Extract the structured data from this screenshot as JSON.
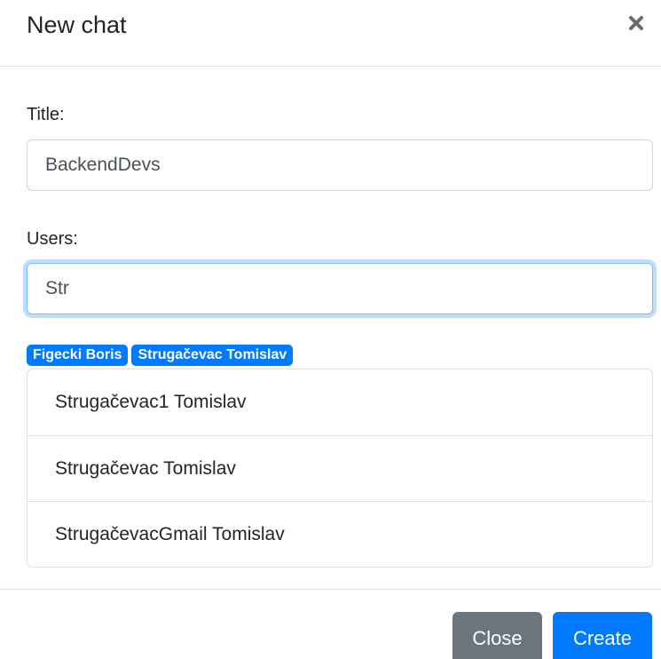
{
  "modal": {
    "title": "New chat"
  },
  "form": {
    "title_label": "Title:",
    "title_value": "BackendDevs",
    "users_label": "Users:",
    "users_value": "Str"
  },
  "selected_users": [
    "Figecki Boris",
    "Strugačevac Tomislav"
  ],
  "suggestions": [
    "Strugačevac1 Tomislav",
    "Strugačevac Tomislav",
    "StrugačevacGmail Tomislav"
  ],
  "footer": {
    "close_label": "Close",
    "create_label": "Create"
  },
  "icons": {
    "close": "close-icon"
  },
  "colors": {
    "primary": "#007bff",
    "secondary": "#6c757d",
    "focus_border": "#80bdff"
  }
}
